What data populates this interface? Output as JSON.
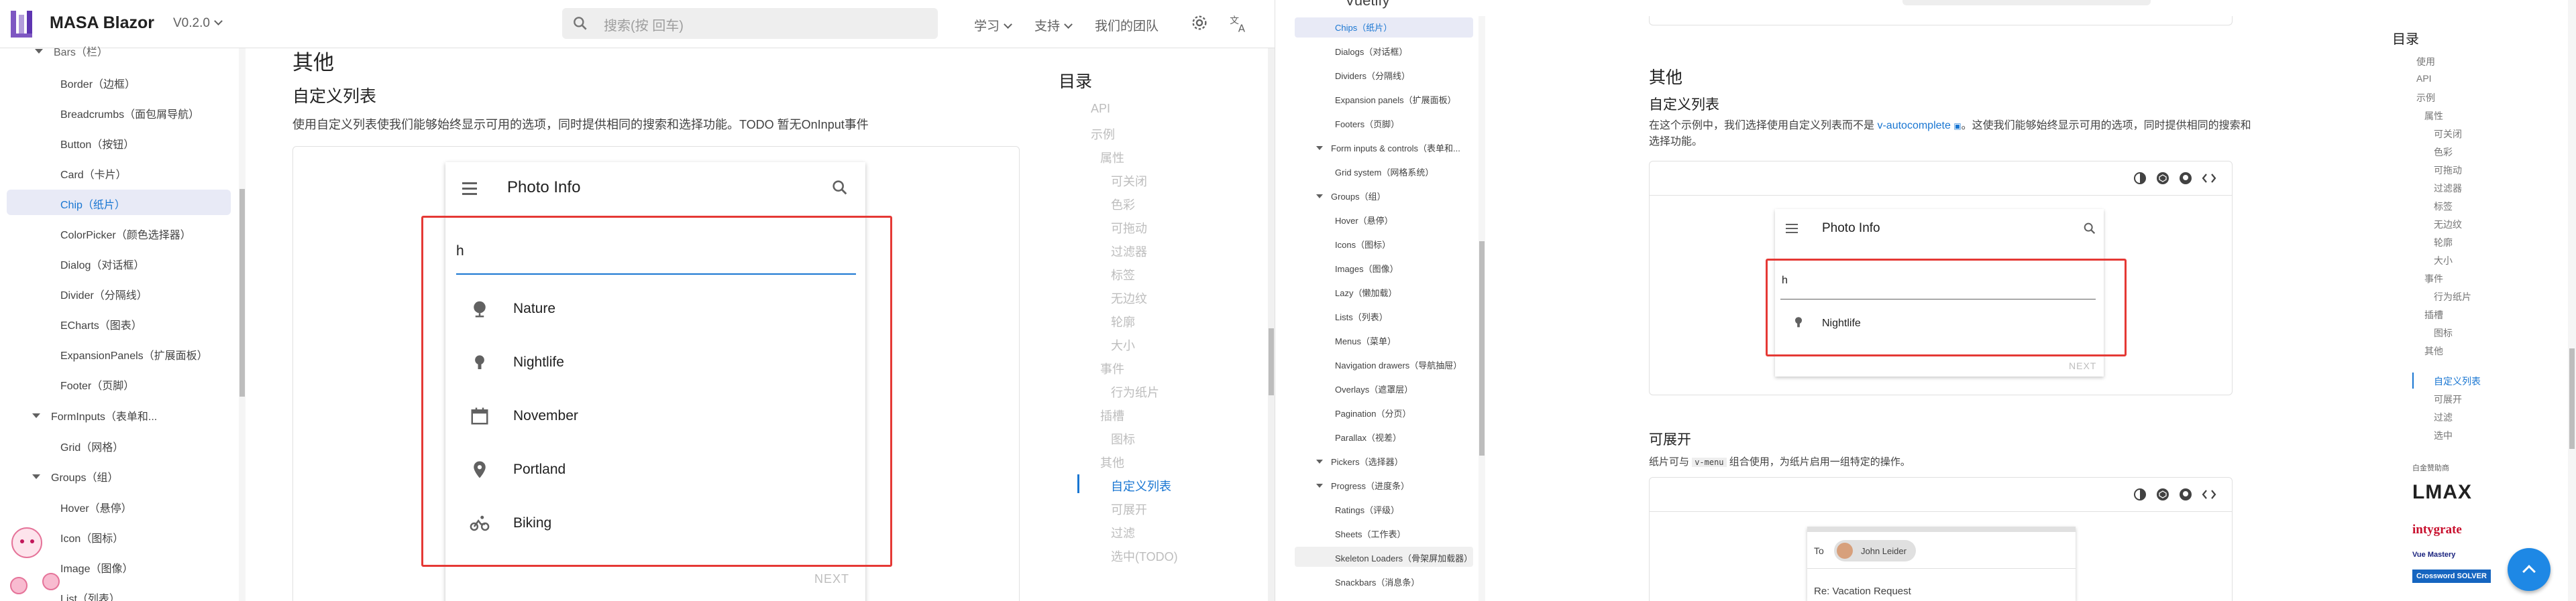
{
  "left": {
    "brand": "MASA Blazor",
    "version": "V0.2.0",
    "search_placeholder": "搜索(按 回车)",
    "nav": [
      "学习",
      "支持",
      "我们的团队"
    ],
    "sidebar": {
      "top_partial": "Bars（栏）",
      "items": [
        "Border（边框）",
        "Breadcrumbs（面包屑导航）",
        "Button（按钮）",
        "Card（卡片）",
        "Chip（纸片）",
        "ColorPicker（颜色选择器）",
        "Dialog（对话框）",
        "Divider（分隔线）",
        "ECharts（图表）",
        "ExpansionPanels（扩展面板）",
        "Footer（页脚）"
      ],
      "group_forminputs": "FormInputs（表单和...",
      "grid": "Grid（网格）",
      "group_groups": "Groups（组）",
      "items2": [
        "Hover（悬停）",
        "Icon（图标）",
        "Image（图像）",
        "List（列表）"
      ]
    },
    "content": {
      "heading": "其他",
      "subheading": "自定义列表",
      "desc": "使用自定义列表使我们能够始终显示可用的选项，同时提供相同的搜索和选择功能。TODO 暂无OnInput事件",
      "card_title": "Photo Info",
      "input_value": "h",
      "list": [
        "Nature",
        "Nightlife",
        "November",
        "Portland",
        "Biking"
      ],
      "next": "NEXT"
    },
    "toc": {
      "title": "目录",
      "items": [
        "API",
        "示例",
        "属性",
        "可关闭",
        "色彩",
        "可拖动",
        "过滤器",
        "标签",
        "无边纹",
        "轮廓",
        "大小",
        "事件",
        "行为纸片",
        "插槽",
        "图标",
        "其他",
        "自定义列表",
        "可展开",
        "过滤",
        "选中(TODO)"
      ],
      "active": "自定义列表"
    }
  },
  "right": {
    "brand_partial": "Vuetify",
    "sidebar": {
      "items_a": [
        "Chips（纸片）",
        "Dialogs（对话框）",
        "Dividers（分隔线）",
        "Expansion panels（扩展面板）",
        "Footers（页脚）"
      ],
      "group_forms": "Form inputs & controls（表单和...",
      "grid": "Grid system（网格系统）",
      "group_groups": "Groups（组）",
      "items_b": [
        "Hover（悬停）",
        "Icons（图标）",
        "Images（图像）",
        "Lazy（懒加载）",
        "Lists（列表）",
        "Menus（菜单）",
        "Navigation drawers（导航抽屉）",
        "Overlays（遮罩层）",
        "Pagination（分页）",
        "Parallax（视差）"
      ],
      "group_pickers": "Pickers（选择器）",
      "group_progress": "Progress（进度条）",
      "items_c": [
        "Ratings（评级）",
        "Sheets（工作表）",
        "Skeleton Loaders（骨架屏加载器）",
        "Snackbars（消息条）"
      ]
    },
    "content": {
      "heading": "其他",
      "subheading": "自定义列表",
      "desc_a": "在这个示例中，我们选择使用自定义列表而不是",
      "desc_link": "v-autocomplete",
      "desc_b": "。这使我们能够始终显示可用的选项，同时提供相同的搜索和选择功能。",
      "card_title": "Photo Info",
      "input_value": "h",
      "list": [
        "Nightlife"
      ],
      "next": "NEXT",
      "heading2": "可展开",
      "desc2_a": "纸片可与",
      "desc2_code": "v-menu",
      "desc2_b": "组合使用，为纸片启用一组特定的操作。",
      "to_label": "To",
      "chip_name": "John Leider",
      "subject": "Re: Vacation Request"
    },
    "toc": {
      "title": "目录",
      "items": [
        "使用",
        "API",
        "示例",
        "属性",
        "可关闭",
        "色彩",
        "可拖动",
        "过滤器",
        "标签",
        "无边纹",
        "轮廓",
        "大小",
        "事件",
        "行为纸片",
        "插槽",
        "图标",
        "其他",
        "自定义列表",
        "可展开",
        "过滤",
        "选中"
      ],
      "active": "自定义列表"
    },
    "sponsors_label": "白金赞助商",
    "sponsors": [
      "LMAX",
      "intygrate",
      "Vue Mastery",
      "Crossword SOLVER"
    ]
  },
  "colors": {
    "accent": "#1976d2",
    "highlight": "#e53935",
    "active_bg": "#e8eaf6"
  }
}
